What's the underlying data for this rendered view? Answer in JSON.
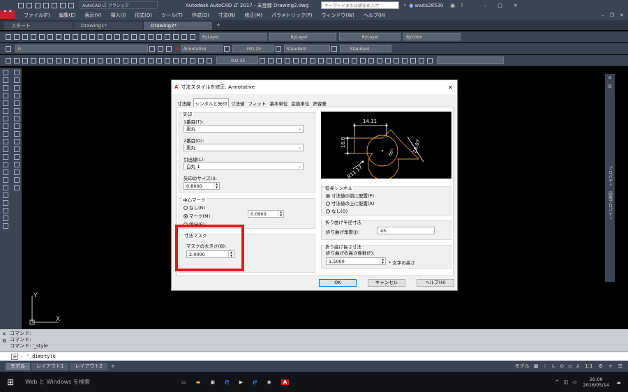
{
  "window": {
    "app_title": "Autodesk AutoCAD LT 2017 - 未登録   Drawing2.dwg",
    "workspace": "AutoCAD LT クラシック",
    "search_placeholder": "キーワードまたは語句を入力",
    "user": "wada28530",
    "app_letter": "A",
    "app_sub": "LT"
  },
  "menu": [
    "ファイル(F)",
    "編集(E)",
    "表示(V)",
    "挿入(I)",
    "形式(O)",
    "ツール(T)",
    "作成(D)",
    "寸法(N)",
    "修正(M)",
    "パラメトリック(P)",
    "ウィンドウ(W)",
    "ヘルプ(H)"
  ],
  "tabs": [
    {
      "label": "スタート",
      "active": false
    },
    {
      "label": "Drawing1*",
      "active": false
    },
    {
      "label": "Drawing2*",
      "active": true
    }
  ],
  "toolbars": {
    "layer_combo": "ByLayer",
    "linetype_combo": "ByLayer",
    "lineweight_combo": "ByLayer",
    "color_combo": "ByColor",
    "layer_name": "0",
    "annotative_style": "Annotative",
    "dim_style": "ISO-25",
    "text_style": "Standard",
    "table_style": "Standard",
    "dim_style2": "ISO-25"
  },
  "command": {
    "history": [
      "コマンド:",
      "コマンド:",
      "コマンド: '_style"
    ],
    "input": "- '_dimstyle"
  },
  "layout_tabs": [
    {
      "label": "モデル",
      "active": true
    },
    {
      "label": "レイアウト1",
      "active": false
    },
    {
      "label": "レイアウト2",
      "active": false
    }
  ],
  "status": {
    "model_label": "モデル",
    "scale": "1:1"
  },
  "taskbar": {
    "search": "Web と Windows を検索",
    "time": "20:00",
    "date": "2016/05/14"
  },
  "dialog": {
    "title": "寸法スタイルを修正: Annotative",
    "tabs": [
      "寸法線",
      "シンボルと矢印",
      "寸法値",
      "フィット",
      "基本単位",
      "変換単位",
      "許容差"
    ],
    "active_tab": 1,
    "arrows": {
      "group": "矢印",
      "first_label": "1番目(T):",
      "first_value": "黒丸",
      "second_label": "2番目(D):",
      "second_value": "黒丸",
      "leader_label": "引出線(L):",
      "leader_value": "白丸 1",
      "size_label": "矢印のサイズ(I):",
      "size_value": "0.8000"
    },
    "center_mark": {
      "group": "中心マーク",
      "options": [
        "なし(N)",
        "マーク(M)",
        "線分(E)"
      ],
      "selected": 1,
      "size_value": "0.0900"
    },
    "dim_break": {
      "group": "寸法マスク",
      "size_label": "マスクの大きさ(B):",
      "size_value": "2.0000"
    },
    "preview": {
      "dims": [
        "14.11",
        "16.6",
        "28.07",
        "R11.17",
        "60°"
      ]
    },
    "arc_symbol": {
      "group": "弧長シンボル",
      "options": [
        "寸法値の前に配置(P)",
        "寸法値の上に配置(A)",
        "なし(O)"
      ],
      "selected": 0
    },
    "radius_jog": {
      "group": "折り曲げ半径寸法",
      "angle_label": "折り曲げ角度(J):",
      "angle_value": "45"
    },
    "linear_jog": {
      "group": "折り曲げ長さ寸法",
      "factor_label": "折り曲げの高さ係数(F):",
      "factor_value": "1.5000",
      "factor_unit": "* 文字の高さ"
    },
    "buttons": {
      "ok": "OK",
      "cancel": "キャンセル",
      "help": "ヘルプ(H)"
    }
  },
  "palette_right": {
    "label": "プロパティ",
    "label2": "画層プロパティ"
  },
  "colors": {
    "accent_red": "#e8141d",
    "app_red": "#c8202f",
    "dark": "#3b4453"
  }
}
